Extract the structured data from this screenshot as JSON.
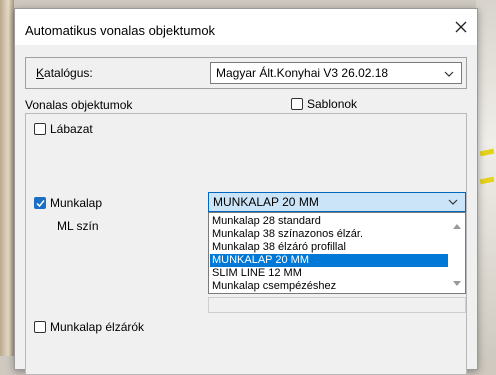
{
  "dialog": {
    "title": "Automatikus vonalas objektumok",
    "close_icon": "close-icon"
  },
  "catalog": {
    "label_underlined": "K",
    "label_rest": "atalógus:",
    "value": "Magyar Ált.Konyhai V3 26.02.18"
  },
  "section": {
    "title": "Vonalas objektumok",
    "templates_label": "Sablonok",
    "templates_checked": false
  },
  "items": {
    "labazat": {
      "label": "Lábazat",
      "checked": false
    },
    "munkalap": {
      "label": "Munkalap",
      "checked": true,
      "selected": "MUNKALAP 20 MM"
    },
    "ml_szin": {
      "label": "ML szín"
    },
    "elzarok": {
      "label": "Munkalap élzárók",
      "checked": false
    }
  },
  "dropdown": {
    "options": [
      "Munkalap 28 standard",
      "Munkalap 38 színazonos élzár.",
      "Munkalap 38 élzáró profillal",
      "MUNKALAP 20 MM",
      "SLIM LINE 12 MM",
      "Munkalap csempézéshez"
    ],
    "selected_index": 3
  },
  "colors": {
    "accent": "#0078d7",
    "selected_field": "#cce4f7",
    "dialog_bg": "#f0f0f0"
  }
}
